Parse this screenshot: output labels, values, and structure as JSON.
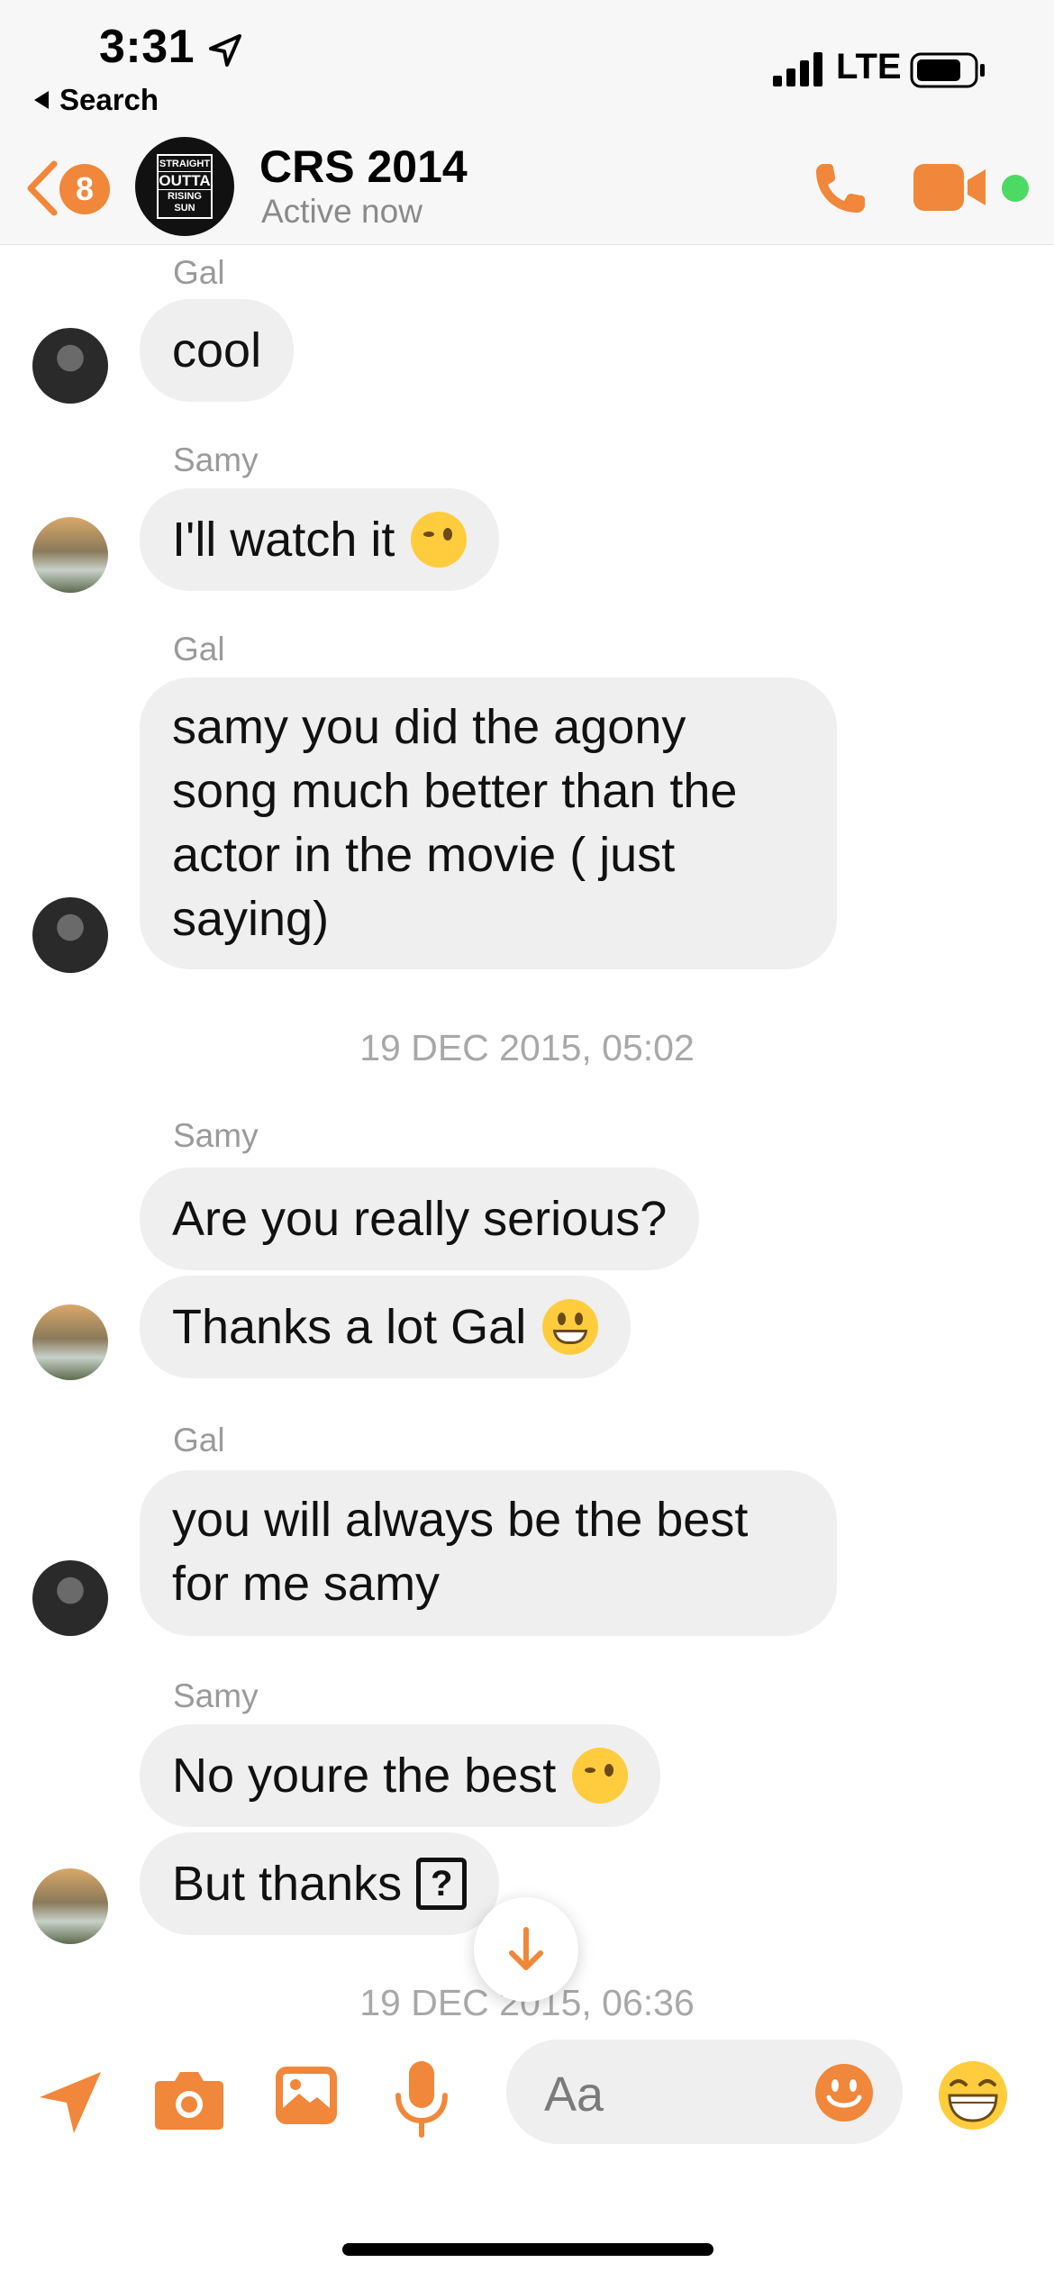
{
  "status_bar": {
    "time": "3:31",
    "back_app_label": "Search",
    "network": "LTE"
  },
  "header": {
    "unread_count": "8",
    "group_avatar_text": [
      "STRAIGHT",
      "OUTTA",
      "RISING SUN"
    ],
    "title": "CRS 2014",
    "status": "Active now"
  },
  "messages": [
    {
      "sender": "Gal",
      "text": "cool"
    },
    {
      "sender": "Samy",
      "text": "I'll watch it",
      "emoji": "wink"
    },
    {
      "sender": "Gal",
      "lines": [
        "samy you did the agony",
        "song much better than the",
        "actor in the movie ( just",
        "saying)"
      ]
    },
    {
      "timestamp": "19 DEC 2015, 05:02"
    },
    {
      "sender": "Samy",
      "text": "Are you really serious?"
    },
    {
      "text": "Thanks a lot Gal",
      "emoji": "grin"
    },
    {
      "sender": "Gal",
      "lines": [
        "you will always be the best",
        "for me samy"
      ]
    },
    {
      "sender": "Samy",
      "text": "No youre the best",
      "emoji": "wink"
    },
    {
      "text": "But thanks",
      "glyph": "?"
    },
    {
      "timestamp": "19 DEC 2015, 06:36"
    }
  ],
  "composer": {
    "placeholder": "Aa"
  },
  "colors": {
    "accent": "#f0873a",
    "bubble": "#efefef",
    "active": "#4cd964"
  }
}
